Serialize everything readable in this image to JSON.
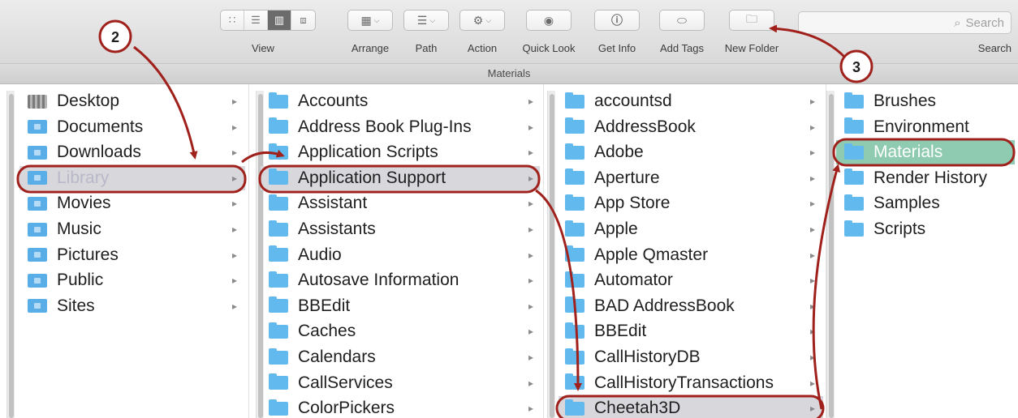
{
  "toolbar": {
    "view_label": "View",
    "arrange_label": "Arrange",
    "path_label": "Path",
    "action_label": "Action",
    "quick_look_label": "Quick Look",
    "get_info_label": "Get Info",
    "add_tags_label": "Add Tags",
    "new_folder_label": "New Folder",
    "search_placeholder": "Search",
    "search_label": "Search"
  },
  "window": {
    "title": "Materials"
  },
  "columns": {
    "sidebar": [
      "Desktop",
      "Documents",
      "Downloads",
      "Library",
      "Movies",
      "Music",
      "Pictures",
      "Public",
      "Sites"
    ],
    "library": [
      "Accounts",
      "Address Book Plug-Ins",
      "Application Scripts",
      "Application Support",
      "Assistant",
      "Assistants",
      "Audio",
      "Autosave Information",
      "BBEdit",
      "Caches",
      "Calendars",
      "CallServices",
      "ColorPickers"
    ],
    "app_support": [
      "accountsd",
      "AddressBook",
      "Adobe",
      "Aperture",
      "App Store",
      "Apple",
      "Apple Qmaster",
      "Automator",
      "BAD AddressBook",
      "BBEdit",
      "CallHistoryDB",
      "CallHistoryTransactions",
      "Cheetah3D"
    ],
    "cheetah": [
      "Brushes",
      "Environment",
      "Materials",
      "Render History",
      "Samples",
      "Scripts"
    ]
  },
  "annotations": {
    "step2": "2",
    "step3": "3"
  },
  "colors": {
    "annotation": "#a0211c",
    "folder": "#62b9ee",
    "selection": "#8fcbb1"
  }
}
